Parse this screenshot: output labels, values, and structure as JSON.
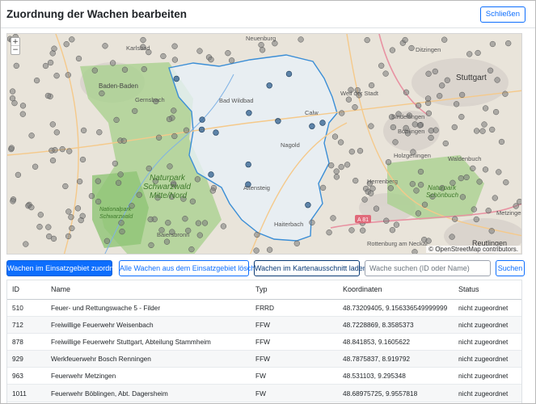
{
  "modal": {
    "title": "Zuordnung der Wachen bearbeiten",
    "close_label": "Schließen"
  },
  "map": {
    "zoom_in": "+",
    "zoom_out": "−",
    "attribution": "© OpenStreetMap contributors.",
    "labels": {
      "neuenburg": "Neuenburg",
      "ditzingen": "Ditzingen",
      "karlsbad": "Karlsbad",
      "baden_baden": "Baden-Baden",
      "stuttgart": "Stuttgart",
      "gernsbach": "Gernsbach",
      "bad_wildbad": "Bad Wildbad",
      "weil_der_stadt": "Weil der Stadt",
      "sindelfingen": "Sindelfingen",
      "boeblingen": "Böblingen",
      "holzgerlingen": "Holzgerlingen",
      "waldenbuch": "Waldenbuch",
      "naturpark_sn_1": "Naturpark",
      "naturpark_sn_2": "Schwarzwald",
      "naturpark_sn_3": "Mitte/Nord",
      "naturpark_schoenbuch_1": "Naturpark",
      "naturpark_schoenbuch_2": "Schönbuch",
      "nationalpark_1": "Nationalpark",
      "nationalpark_2": "Schwarzwald",
      "herrenberg": "Herrenberg",
      "altensteig": "Altensteig",
      "baiersbronn": "Baiersbronn",
      "haiterbach": "Haiterbach",
      "metzingen": "Metzingen",
      "reutlingen": "Reutlingen",
      "rottenburg": "Rottenburg am Neckar",
      "a81": "A 81",
      "nagold": "Nagold",
      "calw": "Calw"
    }
  },
  "toolbar": {
    "assign_label": "Wachen im Einsatzgebiet zuordnen",
    "delete_label": "Alle Wachen aus dem Einsatzgebiet löschen",
    "load_label": "Wachen im Kartenausschnitt laden",
    "search_placeholder": "Wache suchen (ID oder Name)",
    "search_label": "Suchen"
  },
  "table": {
    "headers": [
      "ID",
      "Name",
      "Typ",
      "Koordinaten",
      "Status"
    ],
    "rows": [
      [
        "510",
        "Feuer- und Rettungswache 5 - Filder",
        "FRRD",
        "48.73209405, 9.156336549999999",
        "nicht zugeordnet"
      ],
      [
        "712",
        "Freiwillige Feuerwehr Weisenbach",
        "FFW",
        "48.7228869, 8.3585373",
        "nicht zugeordnet"
      ],
      [
        "878",
        "Freiwillige Feuerwehr Stuttgart, Abteilung Stammheim",
        "FFW",
        "48.841853, 9.1605622",
        "nicht zugeordnet"
      ],
      [
        "929",
        "Werkfeuerwehr Bosch Renningen",
        "FFW",
        "48.7875837, 8.919792",
        "nicht zugeordnet"
      ],
      [
        "963",
        "Feuerwehr Metzingen",
        "FW",
        "48.531103, 9.295348",
        "nicht zugeordnet"
      ],
      [
        "1011",
        "Feuerwehr Böblingen, Abt. Dagersheim",
        "FW",
        "48.68975725, 9.9557818",
        "nicht zugeordnet"
      ]
    ]
  },
  "colors": {
    "primary": "#0d6efd",
    "dark_outline": "#0a3a75",
    "district_fill": "#e7f0f7",
    "district_border": "#3b8ed6",
    "marker_inside": "#2f5f8f",
    "marker_outside": "#7a7a7a",
    "forest": "#a6d08b"
  }
}
